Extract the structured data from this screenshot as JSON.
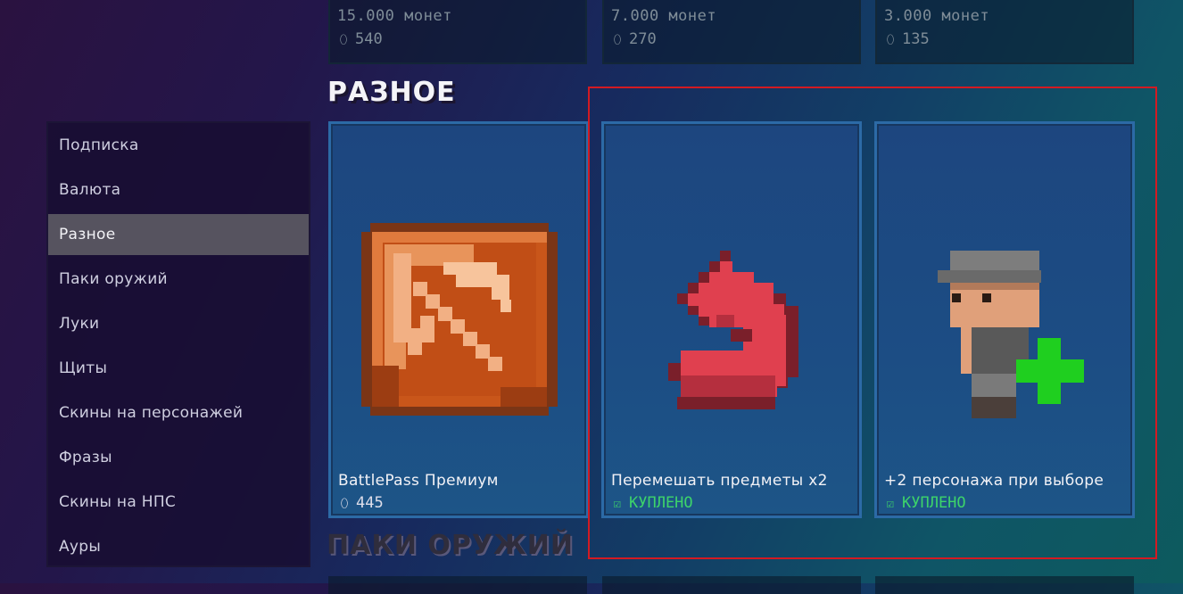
{
  "top_cards": [
    {
      "price": "15.000 монет",
      "coins": "540"
    },
    {
      "price": "7.000 монет",
      "coins": "270"
    },
    {
      "price": "3.000 монет",
      "coins": "135"
    }
  ],
  "section_misc": "РАЗНОЕ",
  "section_weapons": "ПАКИ ОРУЖИЙ",
  "sidebar": {
    "items": [
      {
        "label": "Подписка"
      },
      {
        "label": "Валюта"
      },
      {
        "label": "Разное",
        "active": true
      },
      {
        "label": "Паки оружий"
      },
      {
        "label": "Луки"
      },
      {
        "label": "Щиты"
      },
      {
        "label": "Скины на персонажей"
      },
      {
        "label": "Фразы"
      },
      {
        "label": "Скины на НПС"
      },
      {
        "label": "Ауры"
      }
    ]
  },
  "cards": [
    {
      "title": "BattlePass Премиум",
      "price": "445",
      "icon": "pickaxe-icon"
    },
    {
      "title": "Перемешать предметы x2",
      "status": "КУПЛЕНО",
      "icon": "shuffle-arrow-icon"
    },
    {
      "title": "+2 персонажа при выборе",
      "status": "КУПЛЕНО",
      "icon": "character-plus-icon"
    }
  ],
  "colors": {
    "bought": "#3dd46a",
    "highlight": "#d31a22",
    "active_item": "#56535f"
  }
}
